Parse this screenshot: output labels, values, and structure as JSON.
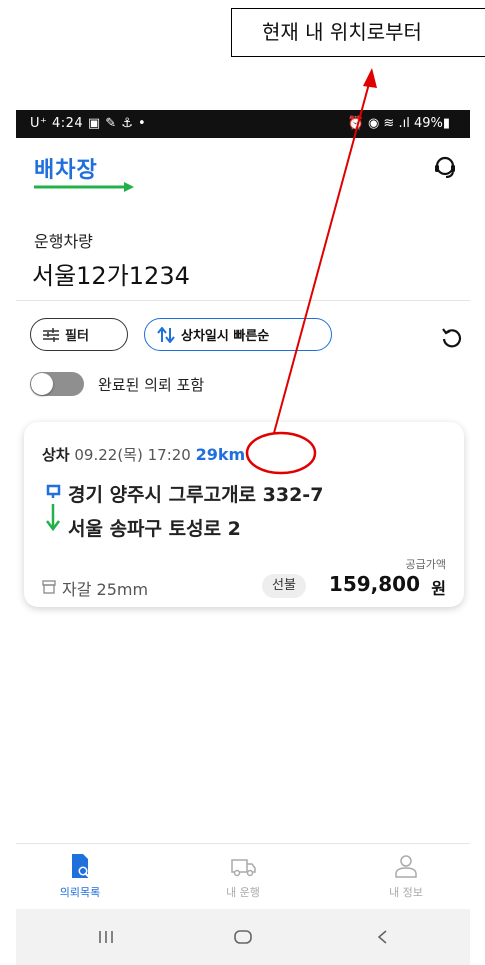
{
  "annotation": {
    "callout_text": "현재 내 위치로부터"
  },
  "status_bar": {
    "left": "U⁺ 4:24 ▣ ✎ ⚓ •",
    "right": "⏰ ◉ ≋ .ıl 49%▮"
  },
  "header": {
    "logo": "배차장"
  },
  "vehicle": {
    "label": "운행차량",
    "plate": "서울12가1234"
  },
  "chips": {
    "filter": "필터",
    "sort": "상차일시 빠른순"
  },
  "toggle": {
    "label": "완료된 의뢰 포함",
    "on": false
  },
  "order_card": {
    "load_label": "상차",
    "load_datetime": "09.22(목) 17:20",
    "distance": "29km",
    "origin": "경기 양주시 그루고개로 332-7",
    "destination": "서울 송파구 토성로 2",
    "supply_price_label": "공급가액",
    "cargo": "자갈 25mm",
    "payment_type": "선불",
    "price": "159,800",
    "currency": "원"
  },
  "bottom_nav": {
    "items": [
      "의뢰목록",
      "내 운행",
      "내 정보"
    ],
    "active": 0
  },
  "colors": {
    "accent": "#1f6fdc",
    "annotation": "#e00000",
    "logo_arrow": "#22b04b"
  },
  "icons": [
    "headset-icon",
    "filter-sliders-icon",
    "sort-arrows-icon",
    "refresh-icon",
    "route-icon",
    "box-icon",
    "document-search-icon",
    "truck-icon",
    "person-icon"
  ]
}
